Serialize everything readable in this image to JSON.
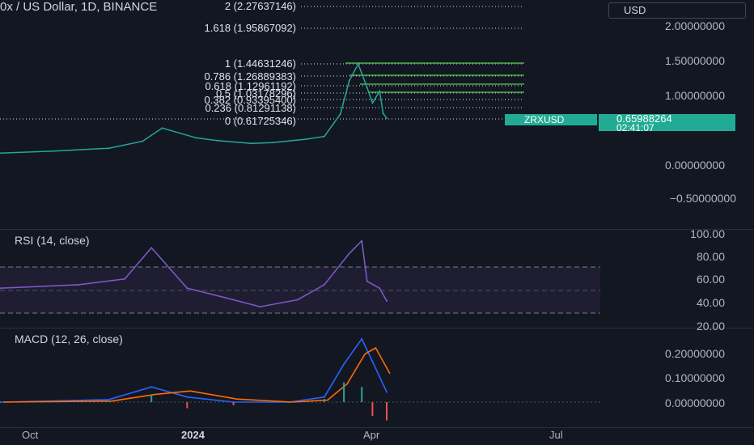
{
  "header": {
    "symbol_title": "0x / US Dollar, 1D, BINANCE",
    "currency": "USD"
  },
  "price_axis": [
    "2.00000000",
    "1.50000000",
    "1.00000000",
    "0.00000000",
    "−0.50000000"
  ],
  "fib_levels": [
    {
      "label": "2 (2.27637146)"
    },
    {
      "label": "1.618 (1.95867092)"
    },
    {
      "label": "1 (1.44631246)"
    },
    {
      "label": "0.786 (1.26889383)"
    },
    {
      "label": "0.618 (1.12961192)"
    },
    {
      "label": "0.5 (1.03178296)"
    },
    {
      "label": "0.382 (0.93395400)"
    },
    {
      "label": "0.236 (0.81291138)"
    },
    {
      "label": "0 (0.61725346)"
    }
  ],
  "last_price": {
    "symbol": "ZRXUSD",
    "price": "0.65988264",
    "countdown": "02:41:07"
  },
  "rsi": {
    "title": "RSI (14, close)",
    "axis": [
      "100.00",
      "80.00",
      "60.00",
      "40.00",
      "20.00"
    ]
  },
  "macd": {
    "title": "MACD (12, 26, close)",
    "axis": [
      "0.20000000",
      "0.10000000",
      "0.00000000"
    ]
  },
  "time_axis": [
    "Oct",
    "2024",
    "Apr",
    "Jul"
  ],
  "colors": {
    "background": "#131722",
    "up": "#26a69a",
    "down": "#ef5350",
    "rsi_line": "#7e57c2",
    "macd_line": "#2962ff",
    "signal_line": "#ff6d00",
    "fib_green": "#4caf50"
  },
  "chart_data": [
    {
      "type": "line",
      "name": "price",
      "x": [
        "2023-09-01",
        "2023-10-01",
        "2023-11-01",
        "2023-11-20",
        "2023-12-01",
        "2023-12-20",
        "2024-01-01",
        "2024-01-20",
        "2024-02-01",
        "2024-02-20",
        "2024-03-01",
        "2024-03-10",
        "2024-03-15",
        "2024-03-20",
        "2024-03-25",
        "2024-03-28",
        "2024-04-01",
        "2024-04-03",
        "2024-04-05"
      ],
      "y": [
        0.16,
        0.19,
        0.23,
        0.33,
        0.52,
        0.38,
        0.34,
        0.3,
        0.31,
        0.36,
        0.4,
        0.72,
        1.2,
        1.44,
        1.1,
        0.88,
        1.05,
        0.73,
        0.66
      ],
      "ylim": [
        -0.6,
        2.3
      ]
    },
    {
      "type": "line",
      "name": "rsi",
      "x": [
        "2023-09-01",
        "2023-10-15",
        "2023-11-10",
        "2023-11-25",
        "2023-12-15",
        "2024-01-05",
        "2024-01-25",
        "2024-02-15",
        "2024-03-01",
        "2024-03-15",
        "2024-03-22",
        "2024-03-25",
        "2024-04-01",
        "2024-04-05"
      ],
      "y": [
        52,
        55,
        60,
        87,
        52,
        44,
        36,
        42,
        55,
        82,
        93,
        58,
        52,
        41
      ],
      "ylim": [
        20,
        100
      ]
    },
    {
      "type": "line",
      "name": "macd",
      "x": [
        "2023-09-01",
        "2023-11-01",
        "2023-11-25",
        "2023-12-15",
        "2024-01-10",
        "2024-02-10",
        "2024-03-01",
        "2024-03-12",
        "2024-03-22",
        "2024-03-28",
        "2024-04-05"
      ],
      "y": [
        0.0,
        0.01,
        0.06,
        0.02,
        0.0,
        0.0,
        0.02,
        0.15,
        0.25,
        0.16,
        0.04
      ],
      "ylim": [
        -0.06,
        0.26
      ]
    }
  ]
}
